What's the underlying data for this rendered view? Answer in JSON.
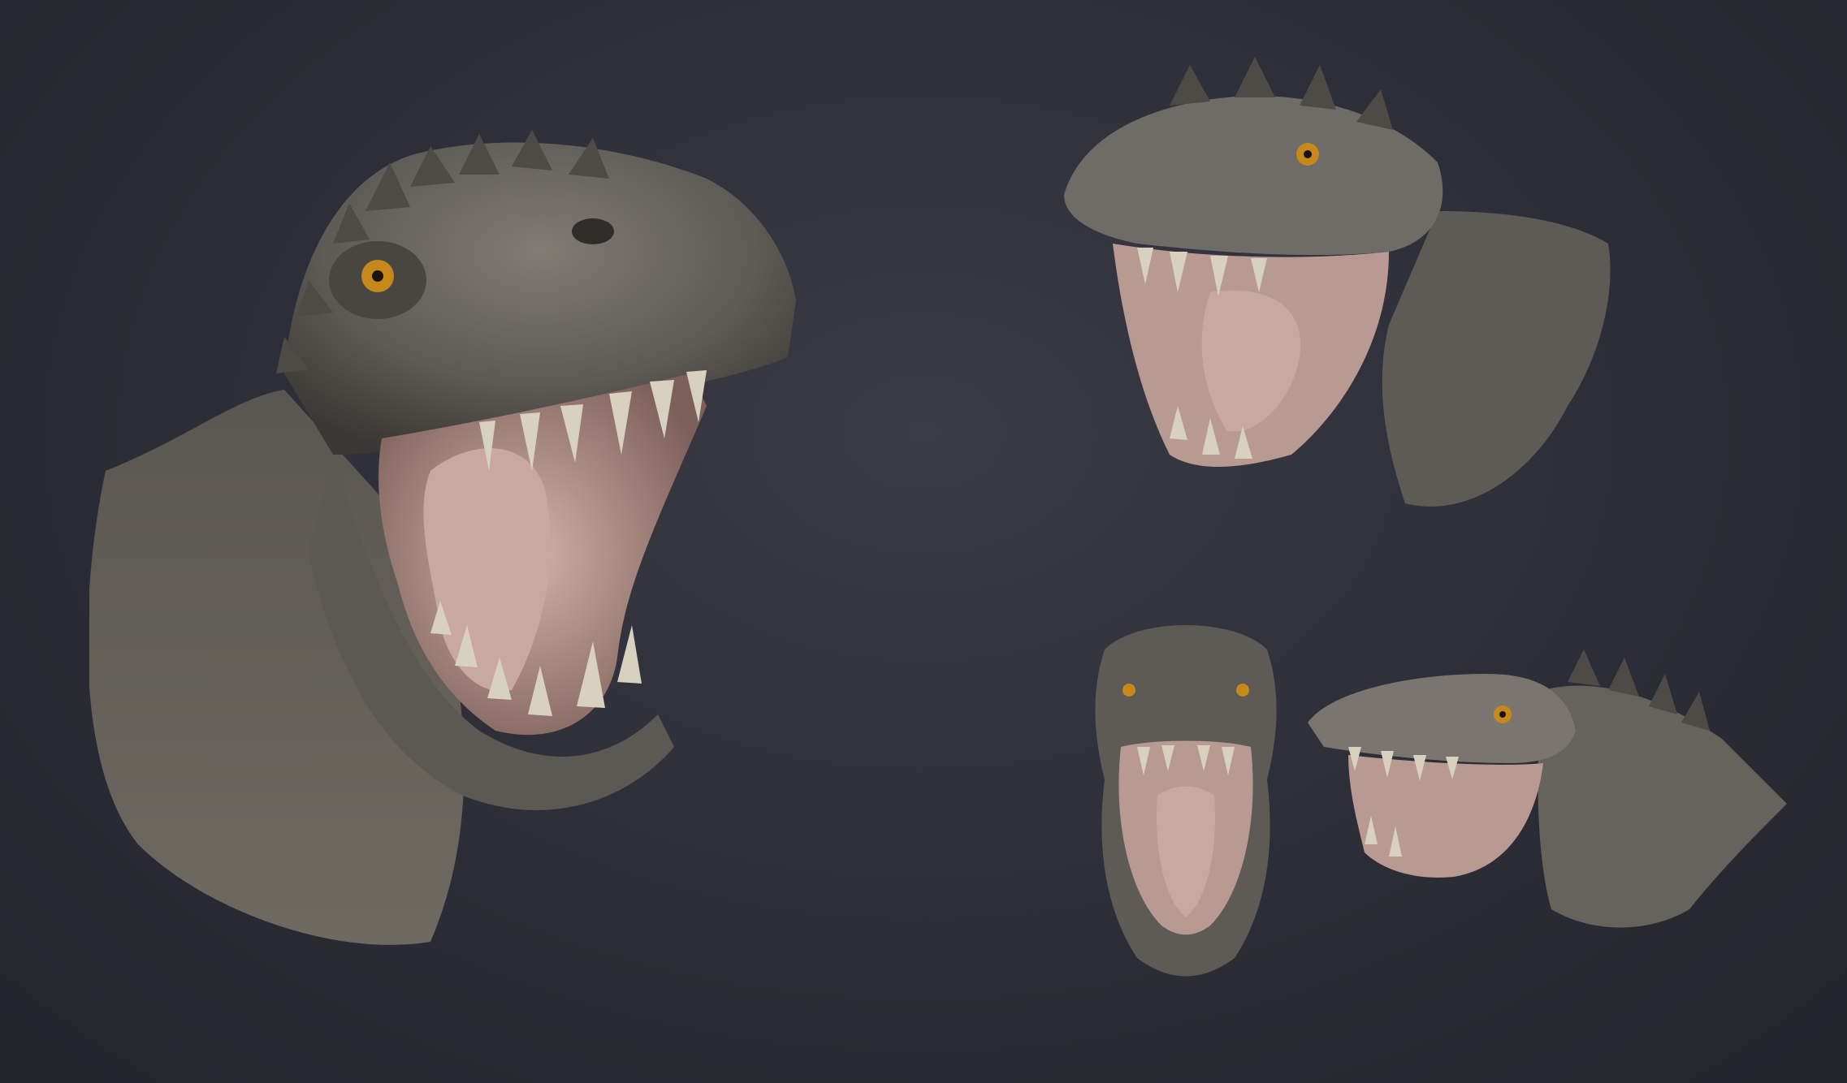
{
  "scene": {
    "background_color": "#2b2c35",
    "subject": "dinosaur-head-sculpt",
    "views": [
      {
        "name": "three-quarter-main",
        "facing": "right"
      },
      {
        "name": "profile",
        "facing": "left"
      },
      {
        "name": "front",
        "facing": "viewer"
      },
      {
        "name": "profile",
        "facing": "left"
      }
    ],
    "colors": {
      "skin": "#6f6b66",
      "skin_dark": "#3e3b38",
      "mouth": "#b89a92",
      "tongue": "#c9a8a0",
      "teeth": "#d9d1bf",
      "eye": "#c8891c"
    }
  }
}
